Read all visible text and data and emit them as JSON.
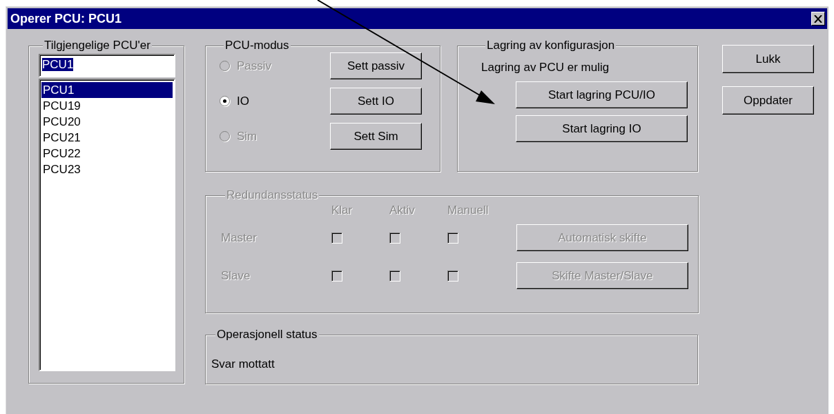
{
  "window": {
    "title": "Operer PCU: PCU1"
  },
  "pcu_group": {
    "title": "Tilgjengelige PCU'er",
    "field_value": "PCU1",
    "items": [
      {
        "label": "PCU1",
        "selected": true
      },
      {
        "label": "PCU19",
        "selected": false
      },
      {
        "label": "PCU20",
        "selected": false
      },
      {
        "label": "PCU21",
        "selected": false
      },
      {
        "label": "PCU22",
        "selected": false
      },
      {
        "label": "PCU23",
        "selected": false
      }
    ]
  },
  "mode_group": {
    "title": "PCU-modus",
    "modes": [
      {
        "label": "Passiv",
        "selected": false,
        "disabled": true,
        "button": "Sett passiv"
      },
      {
        "label": "IO",
        "selected": true,
        "disabled": false,
        "button": "Sett IO"
      },
      {
        "label": "Sim",
        "selected": false,
        "disabled": true,
        "button": "Sett Sim"
      }
    ]
  },
  "storage_group": {
    "title": "Lagring av konfigurasjon",
    "message": "Lagring av PCU er mulig",
    "buttons": [
      "Start lagring PCU/IO",
      "Start lagring IO"
    ]
  },
  "redundancy_group": {
    "title": "Redundansstatus",
    "disabled": true,
    "columns": [
      "Klar",
      "Aktiv",
      "Manuell"
    ],
    "rows": [
      {
        "label": "Master",
        "checks": [
          {
            "checked": false
          },
          {
            "checked": false
          },
          {
            "checked": false
          }
        ]
      },
      {
        "label": "Slave",
        "checks": [
          {
            "checked": false
          },
          {
            "checked": false
          },
          {
            "checked": false
          }
        ]
      }
    ],
    "buttons": [
      "Automatisk skifte",
      "Skifte Master/Slave"
    ]
  },
  "status_group": {
    "title": "Operasjonell status",
    "message": "Svar mottatt"
  },
  "side_buttons": [
    "Lukk",
    "Oppdater"
  ]
}
